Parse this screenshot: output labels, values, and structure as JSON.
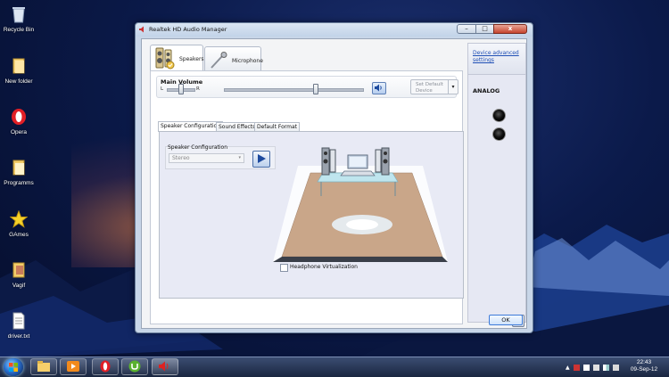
{
  "desktop": {
    "icons": [
      {
        "label": "Recycle Bin",
        "icon": "recycle-bin-icon"
      },
      {
        "label": "New folder",
        "icon": "folder-icon"
      },
      {
        "label": "Opera",
        "icon": "opera-icon"
      },
      {
        "label": "Programms",
        "icon": "folder-icon"
      },
      {
        "label": "GAmes",
        "icon": "star-icon"
      },
      {
        "label": "Vagif",
        "icon": "folder-icon"
      },
      {
        "label": "driver.txt",
        "icon": "text-file-icon"
      }
    ]
  },
  "window": {
    "title": "Realtek HD Audio Manager",
    "close_label": "x",
    "minimize_label": "–",
    "maximize_label": "□",
    "device_tabs": [
      {
        "label": "Speakers",
        "active": true
      },
      {
        "label": "Microphone",
        "active": false
      }
    ],
    "main_volume": {
      "title": "Main Volume",
      "left_label": "L",
      "right_label": "R",
      "balance": 0.5,
      "level": 0.66
    },
    "set_default_button": "Set Default Device",
    "sub_tabs": [
      {
        "label": "Speaker Configuration",
        "active": true
      },
      {
        "label": "Sound Effects",
        "active": false
      },
      {
        "label": "Default Format",
        "active": false
      }
    ],
    "speaker_config": {
      "label": "Speaker Configuration",
      "selected": "Stereo"
    },
    "headphone_virtualization": "Headphone Virtualization",
    "side": {
      "device_advanced_settings": "Device advanced settings",
      "analog_label": "ANALOG"
    },
    "ok_button": "OK",
    "info_button": "i"
  },
  "taskbar": {
    "clock_time": "22:43",
    "clock_date": "09-Sep-12"
  },
  "colors": {
    "accent": "#1f4fb5",
    "desktop_bg": "#0b1a4a",
    "floor": "#c9a689"
  }
}
